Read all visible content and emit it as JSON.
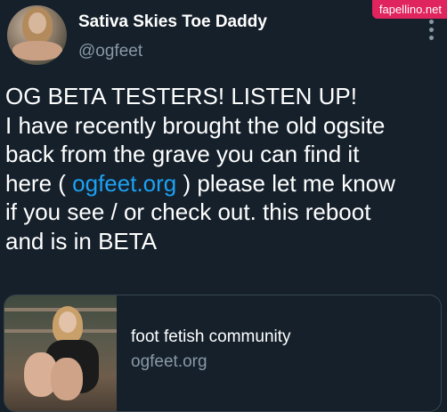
{
  "profile": {
    "display_name": "Sativa Skies Toe Daddy",
    "handle": "@ogfeet"
  },
  "watermark": "fapellino.net",
  "icons": {
    "more": "more-vertical-icon",
    "avatar": "profile-avatar"
  },
  "tweet": {
    "line1": "OG BETA TESTERS! LISTEN UP!",
    "line2": "I have recently brought the old ogsite",
    "line3": "back from the grave you can find it",
    "line4_before": "here ( ",
    "line4_link": "ogfeet.org",
    "line4_after": " ) please let me know",
    "line5": "if you see / or check out. this reboot",
    "line6": "and is in BETA"
  },
  "card": {
    "title": "foot fetish community",
    "domain": "ogfeet.org"
  },
  "colors": {
    "background": "#15202b",
    "link": "#1da1f2",
    "secondary_text": "#8899a6",
    "watermark_bg": "#e0245e"
  }
}
